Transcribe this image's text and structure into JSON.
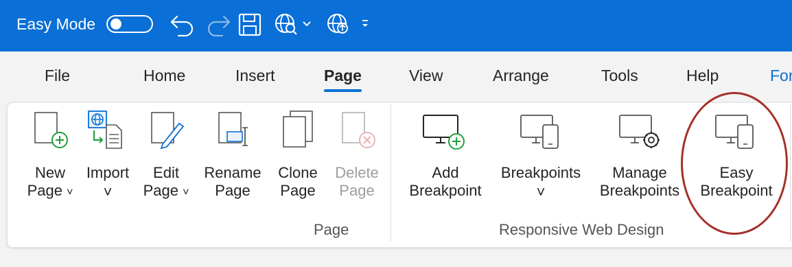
{
  "titlebar": {
    "easy_mode_label": "Easy Mode",
    "easy_mode_on": false,
    "background": "#0a6fd6",
    "icons": [
      "undo-icon",
      "redo-icon",
      "save-icon",
      "preview-globe-icon",
      "publish-globe-icon"
    ]
  },
  "tabs": [
    {
      "label": "File"
    },
    {
      "label": "Home"
    },
    {
      "label": "Insert"
    },
    {
      "label": "Page",
      "active": true
    },
    {
      "label": "View"
    },
    {
      "label": "Arrange"
    },
    {
      "label": "Tools"
    },
    {
      "label": "Help"
    },
    {
      "label": "For"
    }
  ],
  "ribbon": {
    "page_group": {
      "label": "Page",
      "buttons": [
        {
          "line1": "New",
          "line2": "Page",
          "chevron": "˅",
          "icon": "new-page-icon"
        },
        {
          "line1": "Import",
          "line2": "˅",
          "icon": "import-page-icon"
        },
        {
          "line1": "Edit",
          "line2": "Page",
          "chevron": "˅",
          "icon": "edit-page-icon"
        },
        {
          "line1": "Rename",
          "line2": "Page",
          "icon": "rename-page-icon"
        },
        {
          "line1": "Clone",
          "line2": "Page",
          "icon": "clone-page-icon"
        },
        {
          "line1": "Delete",
          "line2": "Page",
          "icon": "delete-page-icon",
          "disabled": true
        }
      ]
    },
    "responsive_group": {
      "label": "Responsive Web Design",
      "buttons": [
        {
          "line1": "Add",
          "line2": "Breakpoint",
          "icon": "add-breakpoint-icon"
        },
        {
          "line1": "Breakpoints",
          "line2": "˅",
          "icon": "breakpoints-icon"
        },
        {
          "line1": "Manage",
          "line2": "Breakpoints",
          "icon": "manage-breakpoints-icon"
        },
        {
          "line1": "Easy",
          "line2": "Breakpoint",
          "icon": "easy-breakpoint-icon"
        }
      ]
    }
  },
  "colors": {
    "accent": "#0a6fd6",
    "add_green": "#1e9e3c",
    "delete_red": "#d9534f",
    "highlight_ring": "#a4302b"
  }
}
